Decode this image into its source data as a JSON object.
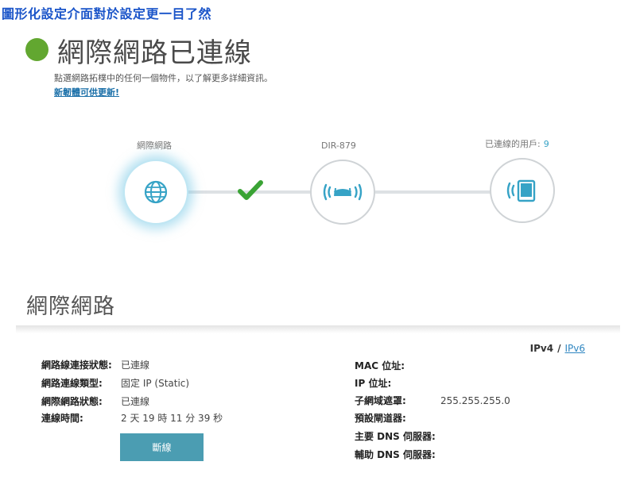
{
  "caption": "圖形化設定介面對於設定更一目了然",
  "status": {
    "title": "網際網路已連線",
    "indicator_color": "#62a730",
    "description": "點選網路拓樸中的任何一個物件，以了解更多詳細資訊。",
    "firmware_link": "新韌體可供更新!"
  },
  "topology": {
    "internet_label": "網際網路",
    "router_label": "DIR-879",
    "clients_label": "已連線的用戶:",
    "clients_count": "9",
    "icons": [
      "globe-icon",
      "check-icon",
      "router-icon",
      "tablet-icon"
    ]
  },
  "section": {
    "title": "網際網路",
    "ip_toggle": {
      "current": "IPv4",
      "separator": "/",
      "alternate": "IPv6"
    }
  },
  "left_details": [
    {
      "label": "網路線連接狀態:",
      "value": "已連線"
    },
    {
      "label": "網路連線類型:",
      "value": "固定 IP (Static)"
    },
    {
      "label": "網際網路狀態:",
      "value": "已連線"
    },
    {
      "label": "連線時間:",
      "value": "2 天 19 時 11 分 39 秒"
    }
  ],
  "right_details": [
    {
      "label": "MAC 位址:",
      "value": ""
    },
    {
      "label": "IP 位址:",
      "value": ""
    },
    {
      "label": "子網域遮罩:",
      "value": "255.255.255.0"
    },
    {
      "label": "預設閘道器:",
      "value": ""
    },
    {
      "label": "主要 DNS 伺服器:",
      "value": ""
    },
    {
      "label": "輔助 DNS 伺服器:",
      "value": ""
    }
  ],
  "disconnect_button": "斷線",
  "colors": {
    "accent": "#36a3c6",
    "button": "#4b9db2",
    "check": "#3aa335",
    "caption": "#1b55c9"
  }
}
